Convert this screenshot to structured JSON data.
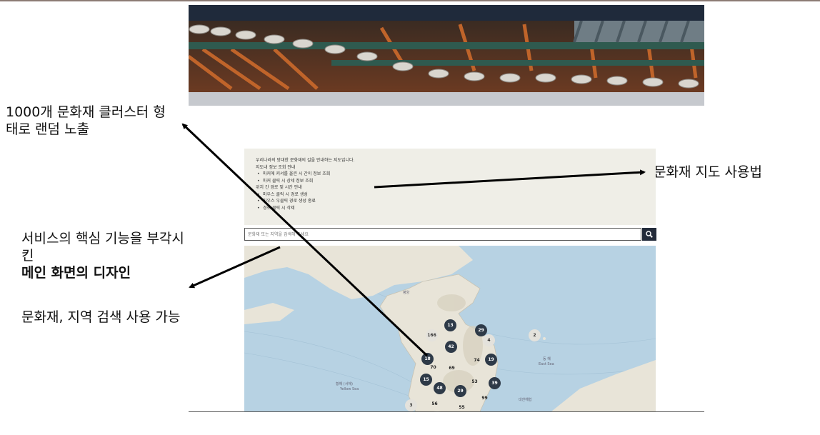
{
  "annotations": {
    "cluster_note": "1000개 문화재 클러스터 형태로 랜덤 노출",
    "usage_note": "문화재 지도 사용법",
    "service_note_line1": "서비스의 핵심 기능을 부각시킨",
    "service_note_line2": "메인 화면의 디자인",
    "search_note": "문화재, 지역 검색 사용 가능"
  },
  "info_panel": {
    "intro": "우리나라의 방대한 문화재의 길을 안내하는 지도입니다.",
    "section1": "지도내 정보 조회 안내",
    "items1": [
      "마커에 커서를 올린 시 간이 정보 조회",
      "마커 클릭 시 상세 정보 조회"
    ],
    "section2": "위치 간 경로 및 시간 안내",
    "items2": [
      "마우스 클릭 시 경로 생성",
      "마우스 우클릭 경로 생성 종료",
      "경로 클릭 시 삭제"
    ]
  },
  "search": {
    "placeholder": "문화재 또는 지역을 검색해 주세요",
    "button_icon": "search-icon"
  },
  "map": {
    "labels": {
      "pyongyang": "평양",
      "yellow_sea": "황해 (서해)",
      "yellow_sea_en": "Yellow Sea",
      "east_sea": "동 해",
      "east_sea_en": "East Sea",
      "korea_strait": "대한해협"
    },
    "clusters": [
      {
        "value": "13",
        "style": "dark"
      },
      {
        "value": "29",
        "style": "dark"
      },
      {
        "value": "166",
        "style": "light"
      },
      {
        "value": "4",
        "style": "light"
      },
      {
        "value": "42",
        "style": "dark"
      },
      {
        "value": "2",
        "style": "light"
      },
      {
        "value": "18",
        "style": "dark"
      },
      {
        "value": "74",
        "style": "plain"
      },
      {
        "value": "19",
        "style": "dark"
      },
      {
        "value": "70",
        "style": "plain"
      },
      {
        "value": "69",
        "style": "plain"
      },
      {
        "value": "15",
        "style": "dark"
      },
      {
        "value": "53",
        "style": "plain"
      },
      {
        "value": "48",
        "style": "dark"
      },
      {
        "value": "29",
        "style": "dark"
      },
      {
        "value": "39",
        "style": "dark"
      },
      {
        "value": "99",
        "style": "plain"
      },
      {
        "value": "3",
        "style": "light"
      },
      {
        "value": "56",
        "style": "plain"
      },
      {
        "value": "55",
        "style": "plain"
      }
    ]
  },
  "colors": {
    "banner_dark": "#1f2a3b",
    "panel_bg": "#efeee7",
    "cluster_dark": "#2e3a48",
    "sea": "#b7d2e3",
    "land": "#e8e4d8"
  }
}
